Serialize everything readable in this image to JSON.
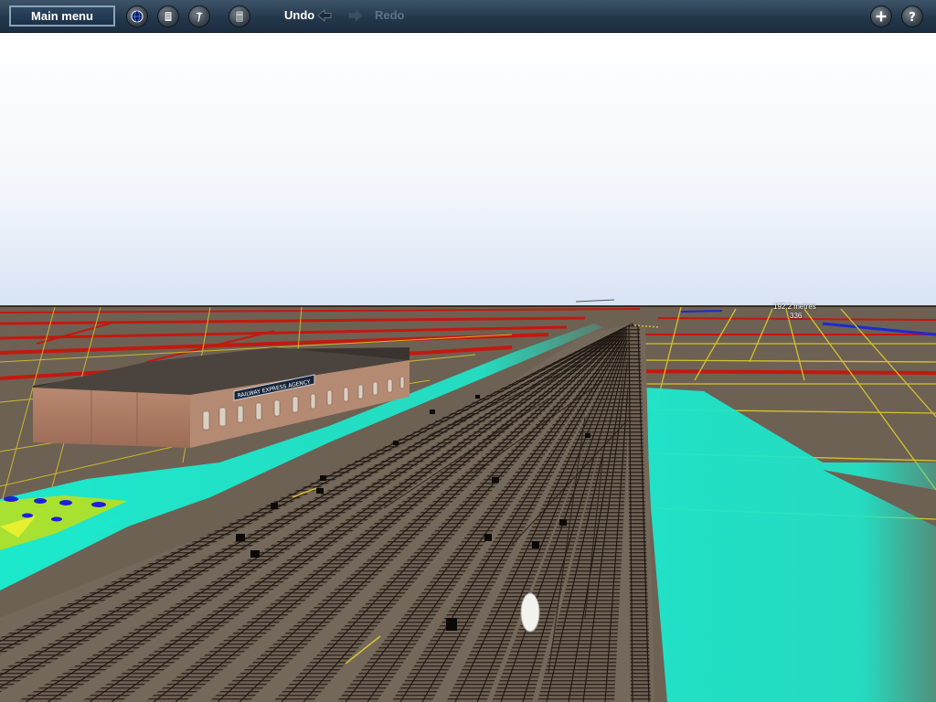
{
  "toolbar": {
    "main_menu_label": "Main menu",
    "undo_label": "Undo",
    "redo_label": "Redo",
    "buttons_left": [
      {
        "name": "globe-icon"
      },
      {
        "name": "document-icon"
      },
      {
        "name": "tool-icon"
      },
      {
        "name": "calculator-icon"
      }
    ],
    "buttons_right": [
      {
        "name": "plus-icon"
      },
      {
        "name": "help-icon"
      }
    ]
  },
  "scene": {
    "building_sign": "RAILWAY EXPRESS AGENCY",
    "measure_distance": "192.2 metres",
    "measure_height": "336"
  },
  "colors": {
    "toolbar_bg": "#24384c",
    "ground": "#6b5e4f",
    "grid": "#d6c830",
    "boundary": "#c81a10",
    "highlight": "#1ee6cc",
    "sky_top": "#ffffff",
    "sky_bottom": "#dfe8f6"
  }
}
